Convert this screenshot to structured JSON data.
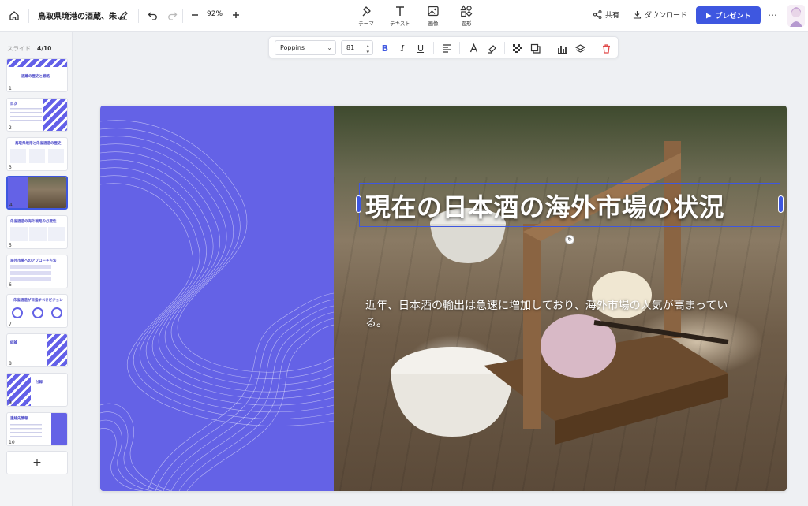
{
  "header": {
    "doc_title": "鳥取県境港の酒蔵、朱...",
    "zoom": "92%",
    "tools": [
      {
        "label": "テーマ",
        "icon": "theme-icon"
      },
      {
        "label": "テキスト",
        "icon": "text-icon"
      },
      {
        "label": "画像",
        "icon": "image-icon"
      },
      {
        "label": "図形",
        "icon": "shapes-icon"
      }
    ],
    "share_label": "共有",
    "download_label": "ダウンロード",
    "present_label": "プレゼント"
  },
  "sidebar": {
    "label": "スライド",
    "current": "4/10",
    "slides": [
      {
        "num": "1",
        "title": "酒蔵の歴史と戦略"
      },
      {
        "num": "2",
        "title": "目次"
      },
      {
        "num": "3",
        "title": "鳥取県境港と朱雀酒造の歴史"
      },
      {
        "num": "4",
        "title": ""
      },
      {
        "num": "5",
        "title": "朱雀酒造の海外戦略の必要性"
      },
      {
        "num": "6",
        "title": "海外市場へのアプローチ方法"
      },
      {
        "num": "7",
        "title": "朱雀酒造が目指すべきビジョン"
      },
      {
        "num": "8",
        "title": "結論"
      },
      {
        "num": "9",
        "title": "付録"
      },
      {
        "num": "10",
        "title": "連絡先情報"
      }
    ],
    "add_label": "+"
  },
  "format_toolbar": {
    "font": "Poppins",
    "size": "81"
  },
  "slide": {
    "title": "現在の日本酒の海外市場の状況",
    "body": "近年、日本酒の輸出は急速に増加しており、海外市場の人気が高まっている。"
  },
  "colors": {
    "accent": "#3e57e0",
    "slide_purple": "#6462e6"
  }
}
